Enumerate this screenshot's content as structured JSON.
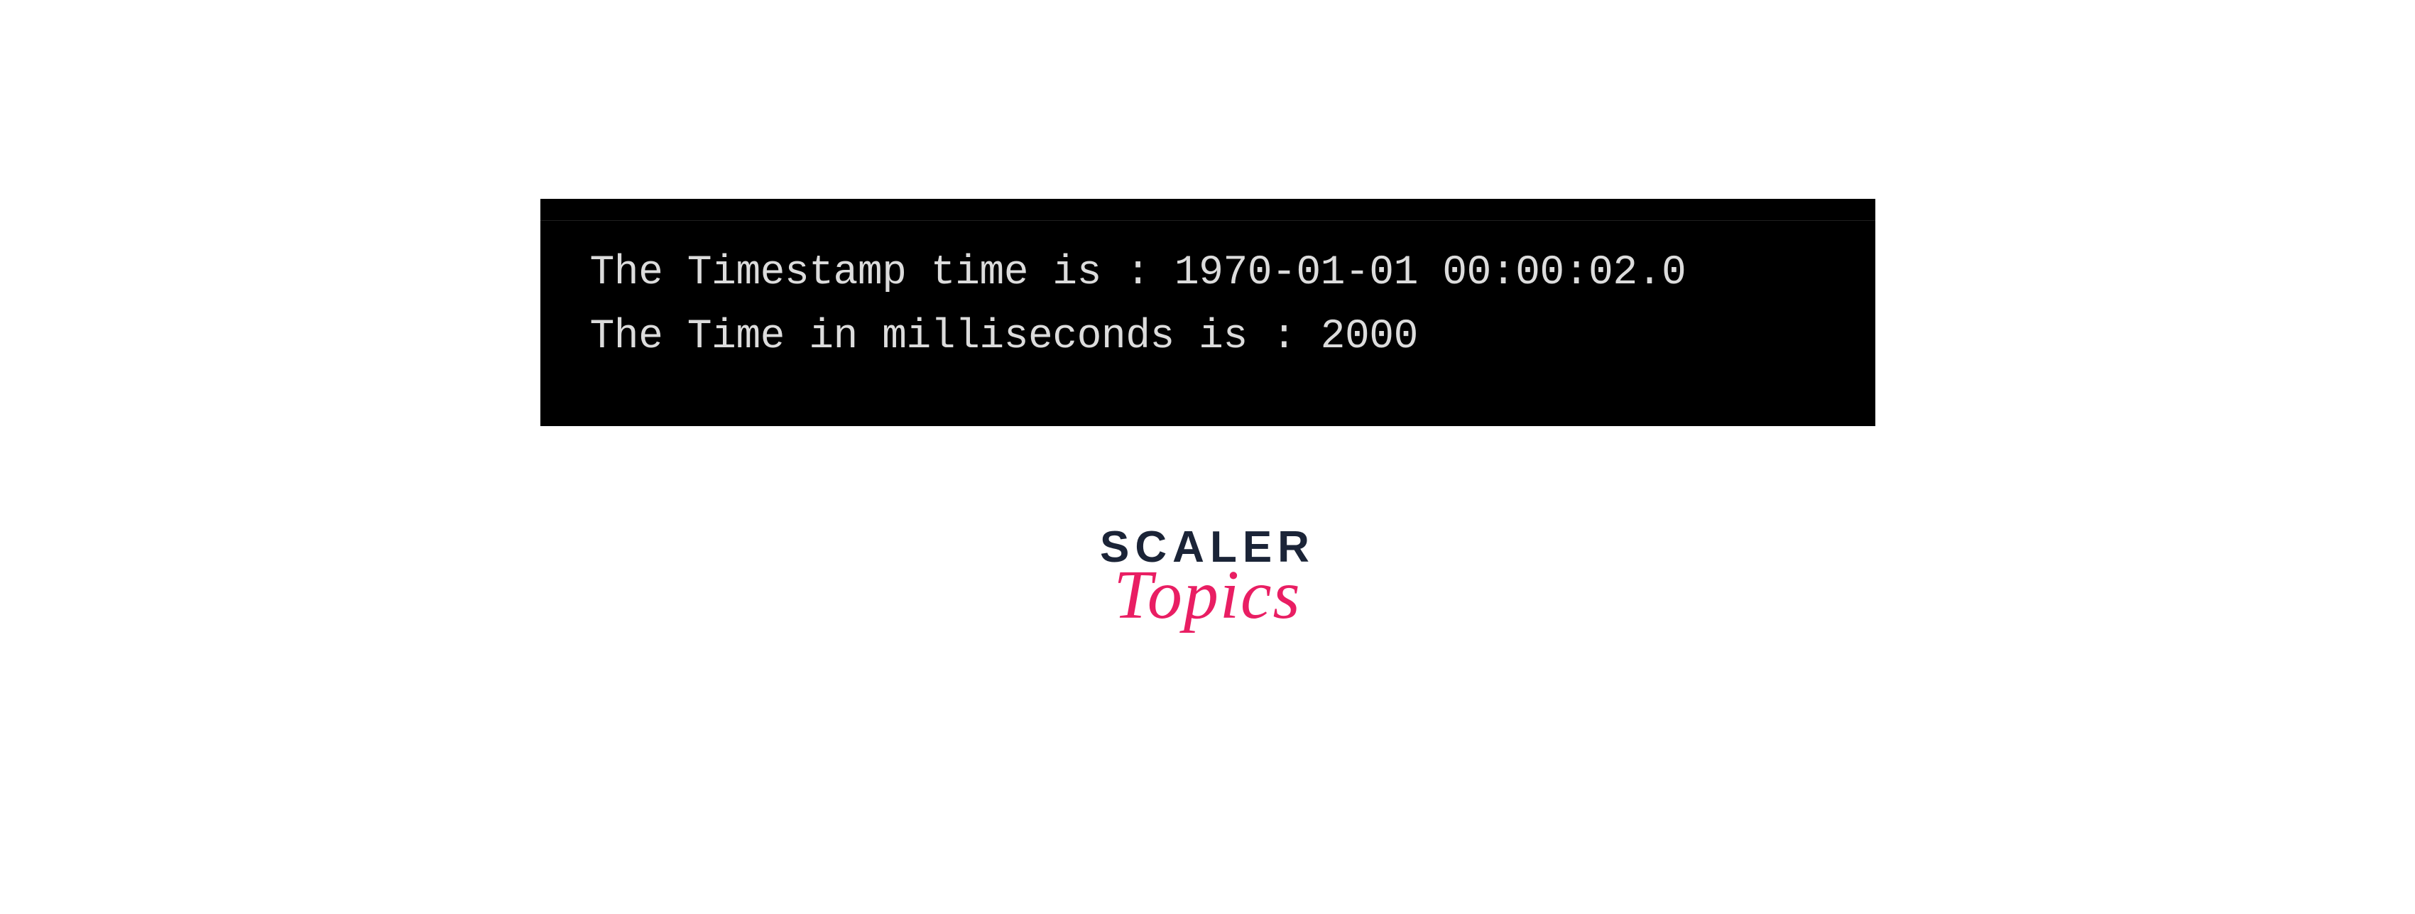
{
  "terminal": {
    "line1": "The Timestamp time is : 1970-01-01 00:00:02.0",
    "line2": "The Time in milliseconds is : 2000"
  },
  "logo": {
    "word1": "SCALER",
    "word2": "Topics"
  }
}
